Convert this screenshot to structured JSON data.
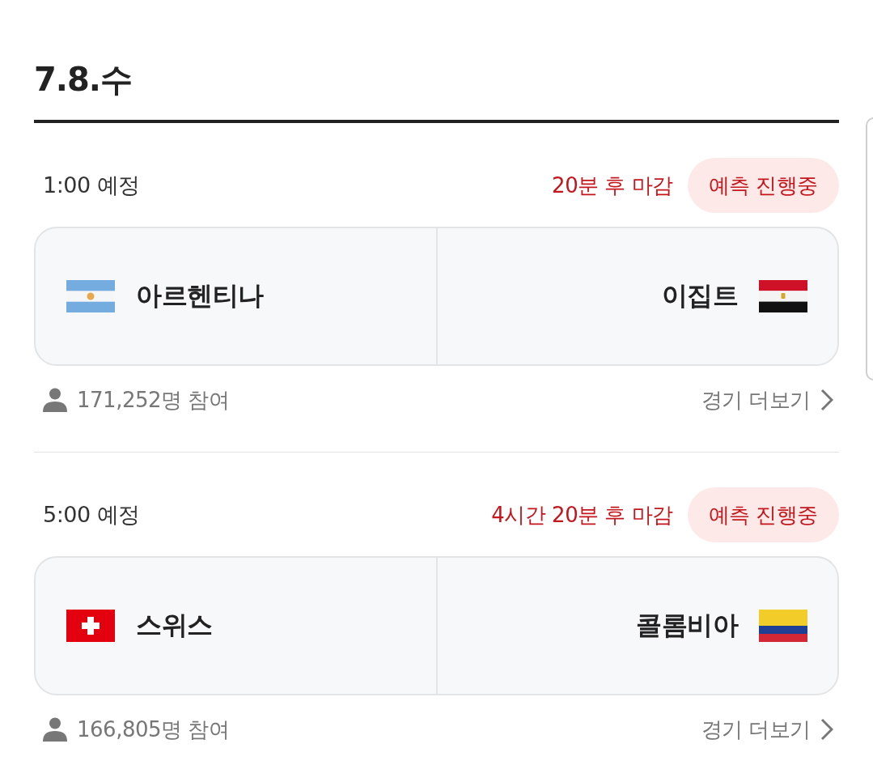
{
  "date_heading": "7.8.수",
  "matches": [
    {
      "time": "1:00 예정",
      "deadline": "20분 후 마감",
      "status": "예측 진행중",
      "home": {
        "name": "아르헨티나",
        "kind": "argentina"
      },
      "away": {
        "name": "이집트",
        "kind": "egypt"
      },
      "participants": "171,252명 참여",
      "more_link": "경기 더보기"
    },
    {
      "time": "5:00 예정",
      "deadline": "4시간 20분 후 마감",
      "status": "예측 진행중",
      "home": {
        "name": "스위스",
        "kind": "switzerland"
      },
      "away": {
        "name": "콜롬비아",
        "kind": "colombia"
      },
      "participants": "166,805명 참여",
      "more_link": "경기 더보기"
    }
  ]
}
